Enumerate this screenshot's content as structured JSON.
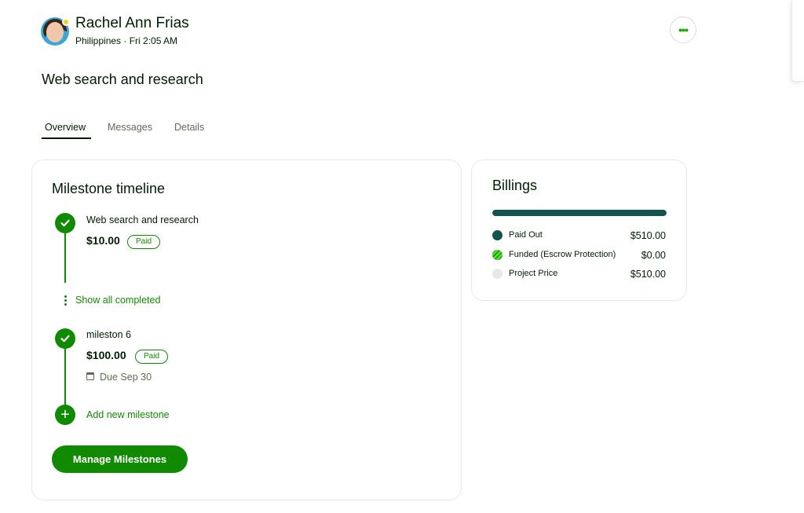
{
  "user": {
    "name": "Rachel Ann Frias",
    "location_time": "Philippines · Fri 2:05 AM"
  },
  "more_button": {
    "icon": "ellipsis-icon",
    "label": "•••"
  },
  "page_title": "Web search and research",
  "tabs": [
    {
      "label": "Overview",
      "active": true
    },
    {
      "label": "Messages",
      "active": false
    },
    {
      "label": "Details",
      "active": false
    }
  ],
  "milestones_card": {
    "title": "Milestone timeline",
    "milestones": [
      {
        "name": "Web search and research",
        "amount": "$10.00",
        "status": "Paid"
      },
      {
        "name": "mileston 6",
        "amount": "$100.00",
        "status": "Paid",
        "due": "Due Sep 30"
      }
    ],
    "show_completed_label": "Show all completed",
    "add_milestone_label": "Add new milestone",
    "manage_button_label": "Manage Milestones"
  },
  "billings": {
    "title": "Billings",
    "paid_fraction": 1.0,
    "items": [
      {
        "label": "Paid Out",
        "value": "$510.00",
        "color": "#13544e"
      },
      {
        "label": "Funded (Escrow Protection)",
        "value": "$0.00",
        "color": "#6fda44"
      },
      {
        "label": "Project Price",
        "value": "$510.00",
        "color": "#e4ebe4"
      }
    ]
  },
  "colors": {
    "brand_green": "#108a00",
    "dark_teal": "#13544e",
    "text": "#001e00",
    "muted": "#5e6d55"
  }
}
